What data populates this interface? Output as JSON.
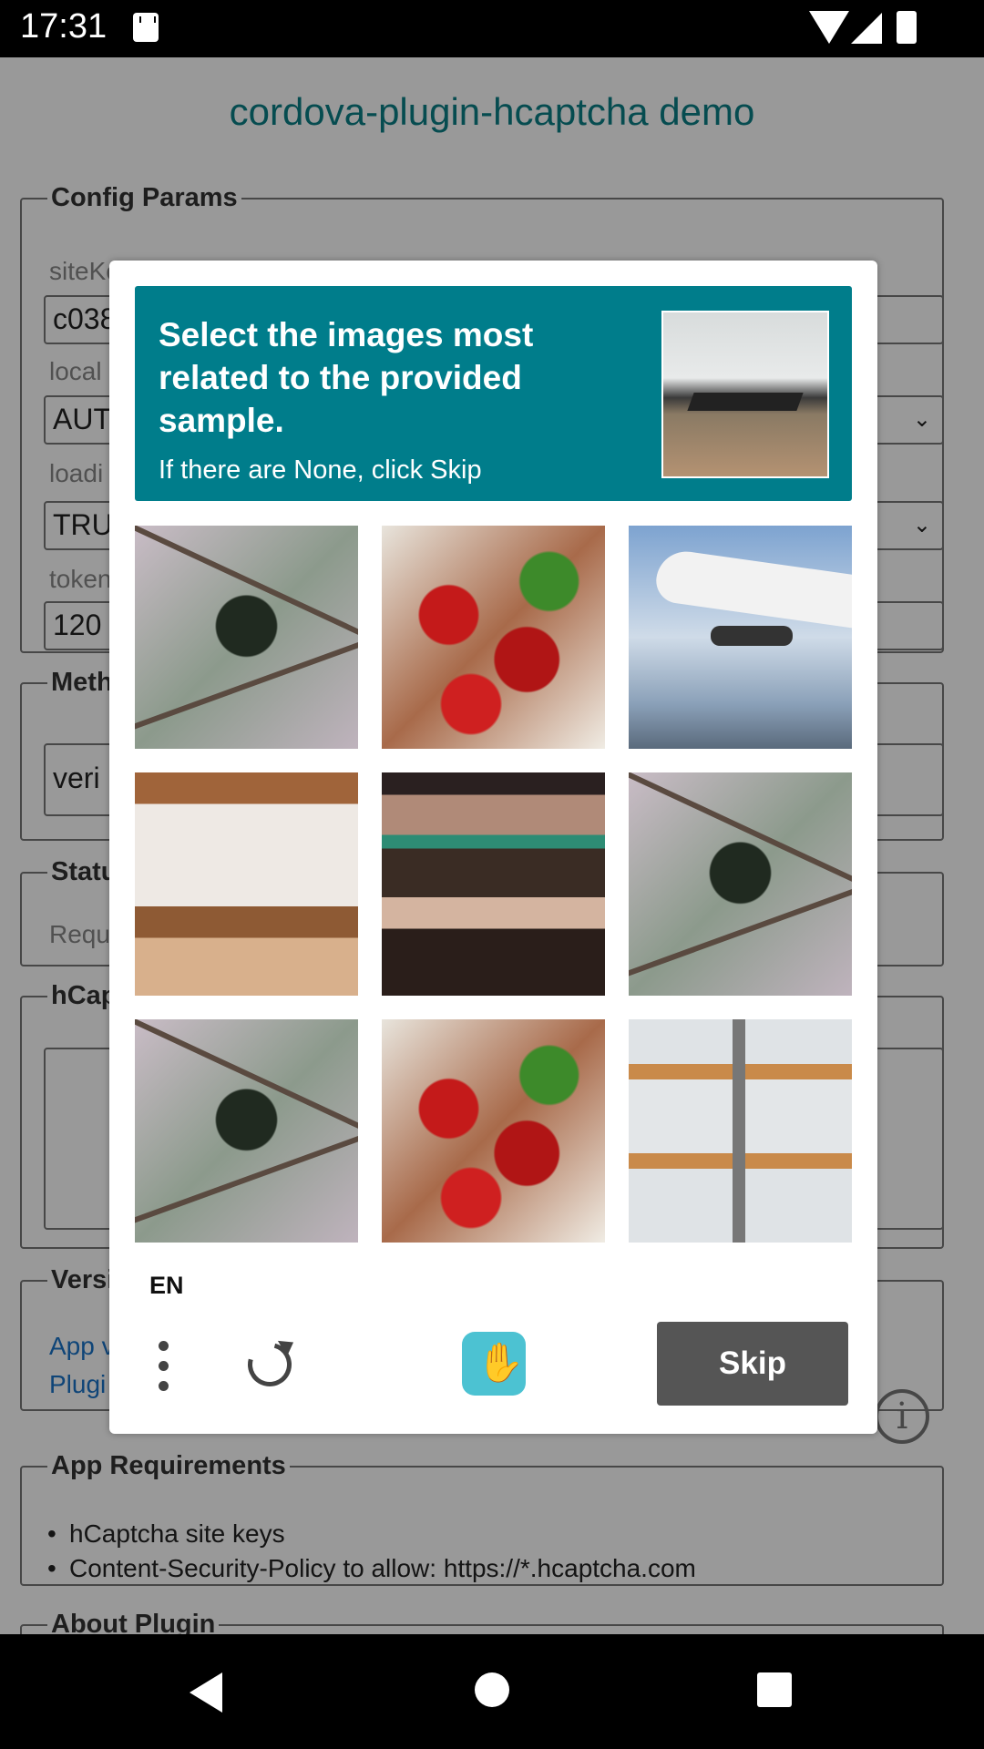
{
  "status_bar": {
    "time": "17:31"
  },
  "page": {
    "title": "cordova-plugin-hcaptcha demo",
    "config": {
      "legend": "Config Params",
      "sitekey_label": "siteKey",
      "sitekey_value": "c038",
      "locale_label": "local",
      "locale_value": "AUT",
      "loading_label": "loadi",
      "loading_value": "TRU",
      "token_label": "token",
      "token_value": "120"
    },
    "methods": {
      "legend": "Meth",
      "value": "veri"
    },
    "status": {
      "legend": "Statu",
      "value": "Requ"
    },
    "hcaptcha": {
      "legend": "hCap"
    },
    "version": {
      "legend": "Versi",
      "app_label": "App v",
      "plugin_label": "Plugi"
    },
    "requirements": {
      "legend": "App Requirements",
      "items": [
        "hCaptcha site keys",
        "Content-Security-Policy to allow: https://*.hcaptcha.com"
      ]
    },
    "about": {
      "legend": "About Plugin"
    }
  },
  "captcha": {
    "prompt": "Select the images most related to the provided sample.",
    "hint": "If there are None, click Skip",
    "language": "EN",
    "skip_label": "Skip",
    "tiles": [
      "crow",
      "apples",
      "airplane",
      "shelf",
      "shelf",
      "crow",
      "crow",
      "apples",
      "shelf"
    ]
  },
  "colors": {
    "accent": "#007d8b",
    "title": "#0b7f86",
    "skip_button": "#555555"
  }
}
